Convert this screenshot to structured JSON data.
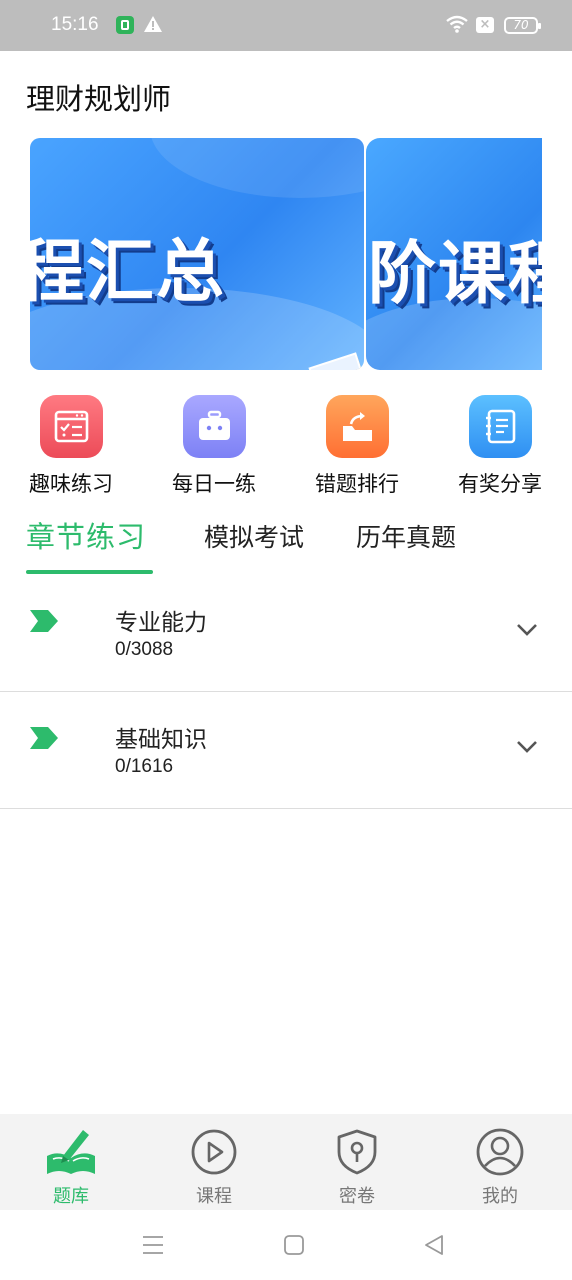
{
  "status_bar": {
    "time": "15:16",
    "battery": "70",
    "icons": [
      "app-notification-icon",
      "warning-icon",
      "wifi-icon",
      "sim-x-icon",
      "battery-icon"
    ]
  },
  "header": {
    "title": "理财规划师"
  },
  "banner": {
    "slides": [
      {
        "text": "程汇总"
      },
      {
        "text": "阶课程"
      }
    ],
    "colors": {
      "primary": "#2f86f2",
      "shadow": "#123c8c"
    }
  },
  "quick_actions": [
    {
      "label": "趣味练习",
      "icon": "checklist-icon",
      "color": "#ec4b58"
    },
    {
      "label": "每日一练",
      "icon": "robot-icon",
      "color": "#7d81f5"
    },
    {
      "label": "错题排行",
      "icon": "share-folder-icon",
      "color": "#ff6f33"
    },
    {
      "label": "有奖分享",
      "icon": "notebook-icon",
      "color": "#2f8ff2"
    }
  ],
  "tabs": [
    {
      "label": "章节练习",
      "active": true
    },
    {
      "label": "模拟考试",
      "active": false
    },
    {
      "label": "历年真题",
      "active": false
    }
  ],
  "chapters": [
    {
      "name": "专业能力",
      "progress": "0/3088"
    },
    {
      "name": "基础知识",
      "progress": "0/1616"
    }
  ],
  "bottom_nav": [
    {
      "label": "题库",
      "icon": "book-pen-icon",
      "active": true
    },
    {
      "label": "课程",
      "icon": "play-circle-icon",
      "active": false
    },
    {
      "label": "密卷",
      "icon": "shield-key-icon",
      "active": false
    },
    {
      "label": "我的",
      "icon": "user-circle-icon",
      "active": false
    }
  ],
  "theme": {
    "accent": "#2dbb6c"
  }
}
